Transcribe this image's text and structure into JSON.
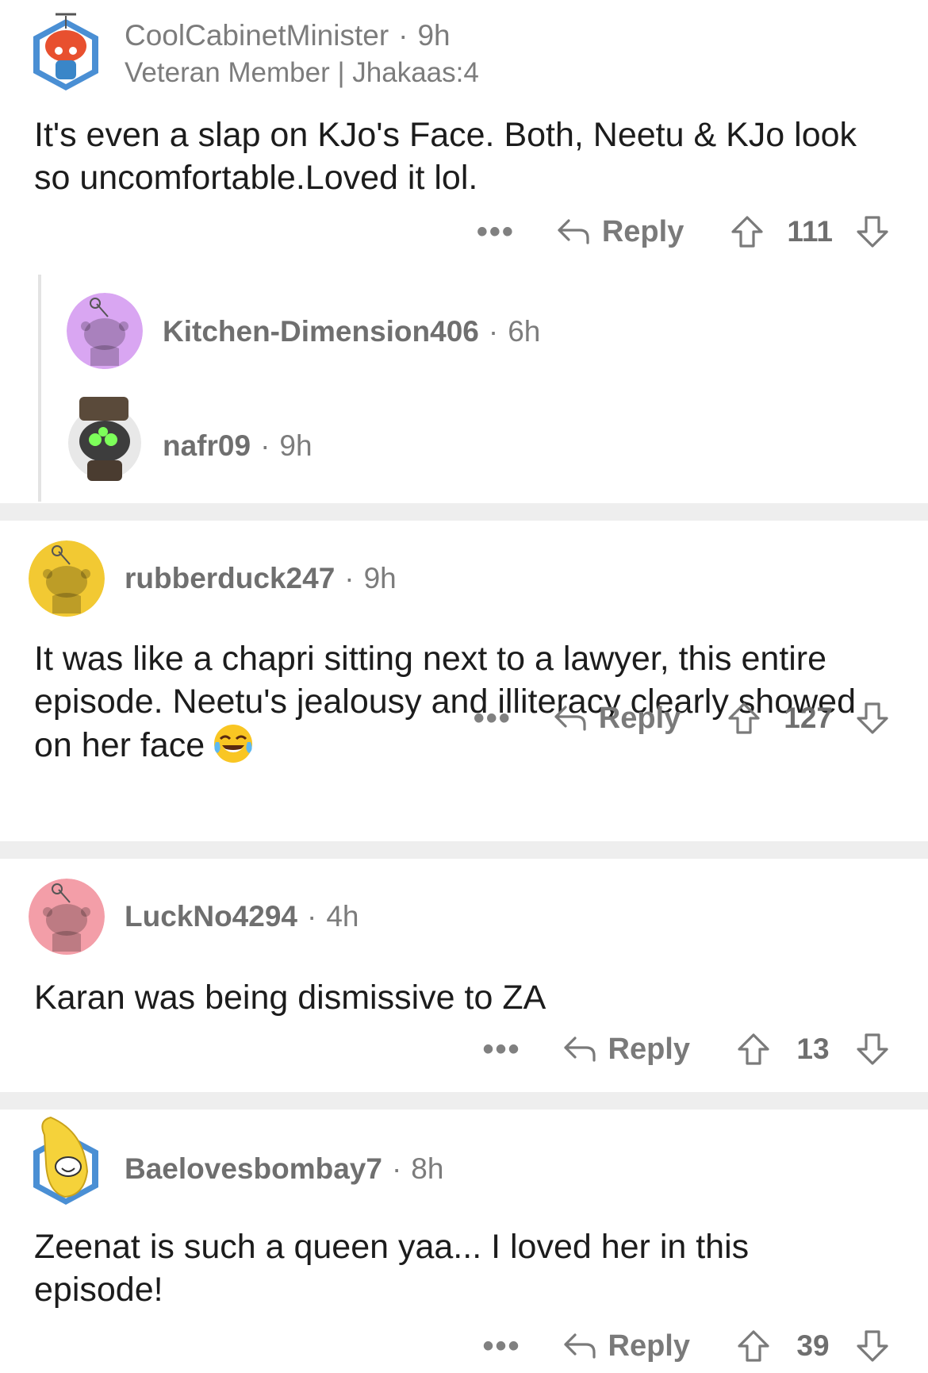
{
  "comments": [
    {
      "username": "CoolCabinetMinister",
      "time": "9h",
      "flair": "Veteran Member | Jhakaas:4",
      "body": "It's even a slap on KJo's Face. Both, Neetu & KJo look so uncomfortable.Loved it lol.",
      "reply_label": "Reply",
      "votes": "111",
      "more": "•••"
    },
    {
      "username": "rubberduck247",
      "time": "9h",
      "body": "It was like a chapri sitting next to a lawyer, this entire episode. Neetu's jealousy and illiteracy clearly showed on her face",
      "reply_label": "Reply",
      "votes": "127",
      "more": "•••"
    },
    {
      "username": "LuckNo4294",
      "time": "4h",
      "body": "Karan was being dismissive to ZA",
      "reply_label": "Reply",
      "votes": "13",
      "more": "•••"
    },
    {
      "username": "Baelovesbombay7",
      "time": "8h",
      "body": "Zeenat is such a queen yaa... I loved her in this episode!",
      "reply_label": "Reply",
      "votes": "39",
      "more": "•••"
    }
  ],
  "collapsed_replies": [
    {
      "username": "Kitchen-Dimension406",
      "time": "6h"
    },
    {
      "username": "nafr09",
      "time": "9h"
    }
  ],
  "icons": {
    "reply": "reply-arrow-icon",
    "upvote": "upvote-arrow-icon",
    "downvote": "downvote-arrow-icon",
    "emoji": "tears-of-joy-emoji"
  },
  "colors": {
    "separator": "#eeeeee",
    "meta_text": "#7c7c7c",
    "avatar_purple": "#d9a6f2",
    "avatar_yellow": "#f2c933",
    "avatar_pink": "#f39ea8"
  }
}
